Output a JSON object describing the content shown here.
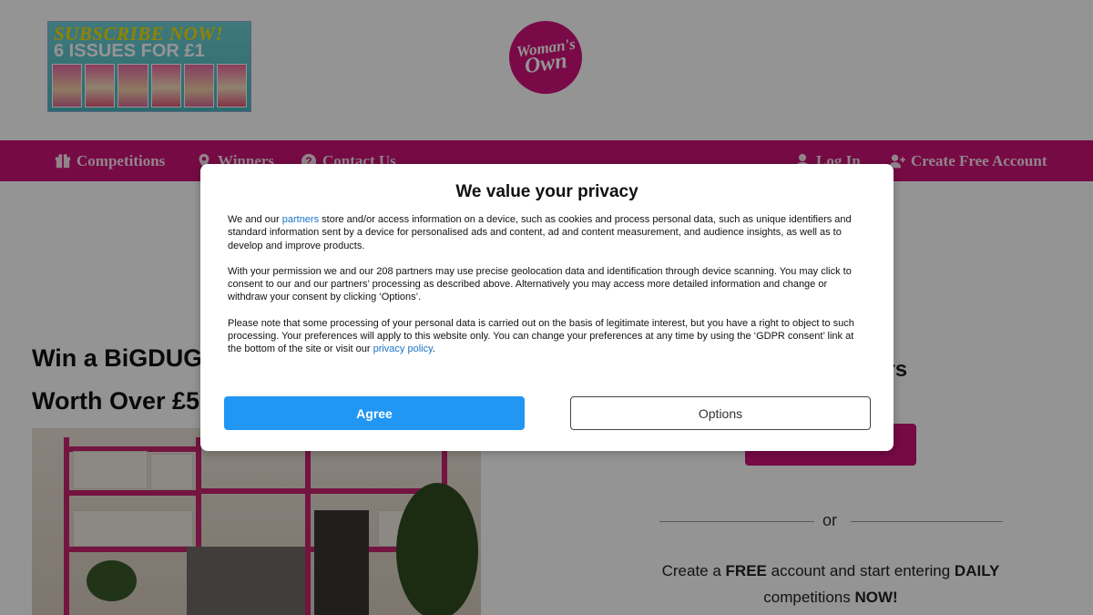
{
  "header": {
    "promo_line1": "SUBSCRIBE NOW!",
    "promo_line2": "6 ISSUES FOR £1",
    "logo_line1": "Woman's",
    "logo_line2": "Own"
  },
  "nav": {
    "left": [
      {
        "label": "Competitions",
        "icon": "gift-icon"
      },
      {
        "label": "Winners",
        "icon": "map-pin-icon"
      },
      {
        "label": "Contact Us",
        "icon": "question-circle-icon"
      }
    ],
    "right": [
      {
        "label": "Log In",
        "icon": "user-icon"
      },
      {
        "label": "Create Free Account",
        "icon": "user-plus-icon"
      }
    ]
  },
  "main": {
    "title_line1": "Win a BiGDUG",
    "title_line2": "Worth Over £5",
    "right_heading": "ers",
    "or": "or",
    "cta_parts": [
      "Create a ",
      "FREE",
      " account and start entering ",
      "DAILY",
      " competitions ",
      "NOW!"
    ]
  },
  "dialog": {
    "title": "We value your privacy",
    "p1_before": "We and our ",
    "p1_link": "partners",
    "p1_after": " store and/or access information on a device, such as cookies and process personal data, such as unique identifiers and standard information sent by a device for personalised ads and content, ad and content measurement, and audience insights, as well as to develop and improve products.",
    "p2": "With your permission we and our 208 partners may use precise geolocation data and identification through device scanning. You may click to consent to our and our partners’ processing as described above. Alternatively you may access more detailed information and change or withdraw your consent by clicking ‘Options’.",
    "p3_before": "Please note that some processing of your personal data is carried out on the basis of legitimate interest, but you have a right to object to such processing. Your preferences will apply to this website only. You can change your preferences at any time by using the ‘GDPR consent’ link at the bottom of the site or visit our ",
    "p3_link": "privacy policy",
    "p3_after": ".",
    "agree": "Agree",
    "options": "Options"
  },
  "colors": {
    "brand_pink": "#cc1278",
    "agree_blue": "#2196f3",
    "link_blue": "#1a73c8"
  }
}
